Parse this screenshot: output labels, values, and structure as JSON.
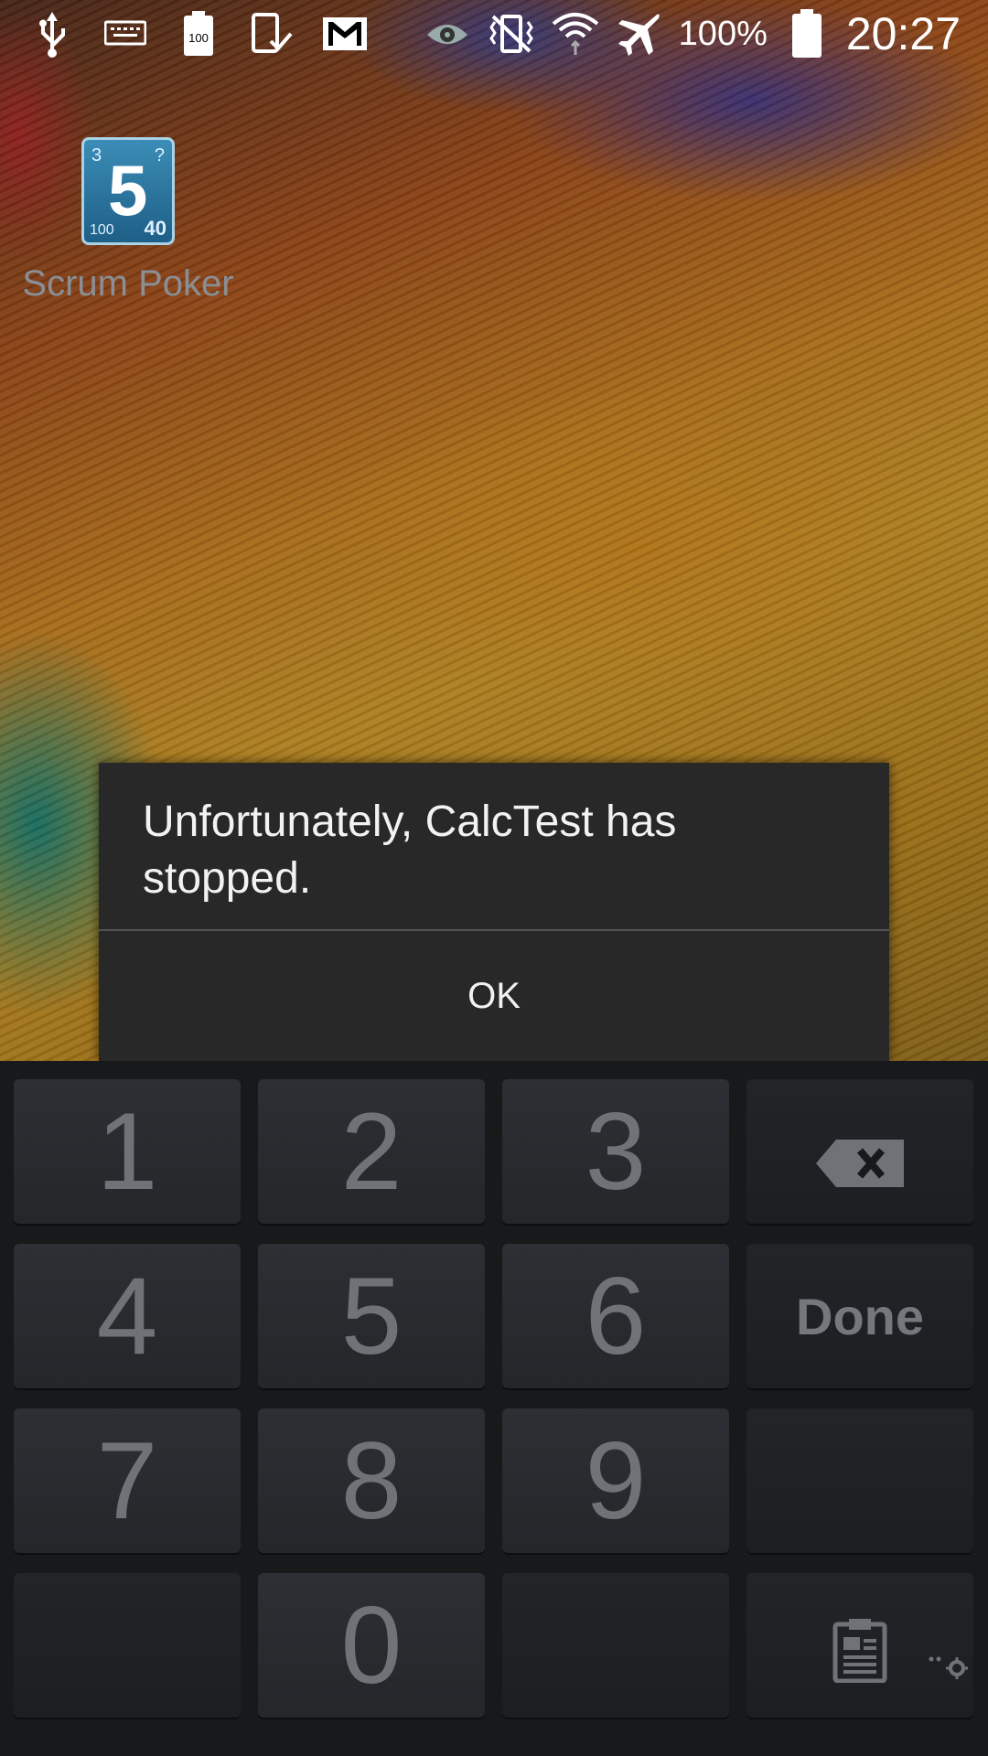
{
  "status_bar": {
    "left_icons": [
      "usb-icon",
      "keyboard-icon",
      "battery-saver-icon",
      "screen-check-icon",
      "gmail-icon"
    ],
    "right_icons": [
      "eye-icon",
      "vibrate-icon",
      "wifi-icon",
      "airplane-icon",
      "battery-icon"
    ],
    "battery_text": "100%",
    "battery_level": 100,
    "clock": "20:27",
    "small_badge": "100"
  },
  "home": {
    "app_label": "Scrum Poker",
    "app_icon": {
      "big": "5",
      "top_left": "3",
      "top_right": "?",
      "bottom_left": "100",
      "bottom_right": "40"
    }
  },
  "dialog": {
    "message": "Unfortunately, CalcTest has stopped.",
    "ok_label": "OK"
  },
  "keyboard": {
    "row1": [
      "1",
      "2",
      "3"
    ],
    "row2": [
      "4",
      "5",
      "6"
    ],
    "row3": [
      "7",
      "8",
      "9"
    ],
    "zero": "0",
    "done_label": "Done",
    "backspace_icon": "backspace-icon",
    "clipboard_icon": "clipboard-icon",
    "settings_icon": "gear-icon"
  }
}
